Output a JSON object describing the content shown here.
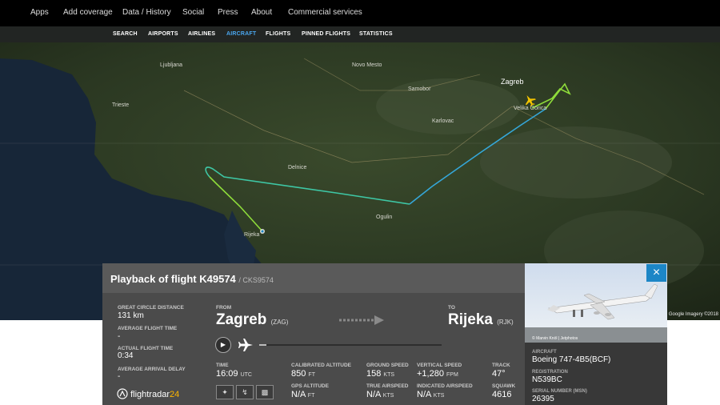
{
  "topnav": [
    {
      "label": "Apps"
    },
    {
      "label": "Add coverage"
    },
    {
      "label": "Data / History"
    },
    {
      "label": "Social"
    },
    {
      "label": "Press"
    },
    {
      "label": "About"
    },
    {
      "label": "Commercial services"
    }
  ],
  "subnav": [
    {
      "label": "SEARCH",
      "active": false
    },
    {
      "label": "AIRPORTS",
      "active": false
    },
    {
      "label": "AIRLINES",
      "active": false
    },
    {
      "label": "AIRCRAFT",
      "active": true
    },
    {
      "label": "FLIGHTS",
      "active": false
    },
    {
      "label": "PINNED FLIGHTS",
      "active": false
    },
    {
      "label": "STATISTICS",
      "active": false
    }
  ],
  "map": {
    "places": [
      "Zagreb",
      "Velika Gorica",
      "Samobor",
      "Trieste",
      "Rijeka",
      "Ljubljana",
      "Novo Mesto",
      "Karlovac",
      "Ogulin",
      "Delnice"
    ],
    "attribution": "Google Imagery ©2018"
  },
  "panel": {
    "title": "Playback of flight K49574",
    "callsign": "/ CKS9574",
    "great_circle_label": "GREAT CIRCLE DISTANCE",
    "great_circle_value": "131 km",
    "avg_flight_label": "AVERAGE FLIGHT TIME",
    "avg_flight_value": "-",
    "actual_flight_label": "ACTUAL FLIGHT TIME",
    "actual_flight_value": "0:34",
    "avg_delay_label": "AVERAGE ARRIVAL DELAY",
    "avg_delay_value": "-",
    "from_label": "FROM",
    "from_city": "Zagreb",
    "from_code": "(ZAG)",
    "to_label": "TO",
    "to_city": "Rijeka",
    "to_code": "(RJK)",
    "time_label": "TIME",
    "time_value": "16:09",
    "time_unit": "UTC",
    "cal_alt_label": "CALIBRATED ALTITUDE",
    "cal_alt_value": "850",
    "cal_alt_unit": "FT",
    "gps_alt_label": "GPS ALTITUDE",
    "gps_alt_value": "N/A",
    "gps_alt_unit": "FT",
    "ground_speed_label": "GROUND SPEED",
    "ground_speed_value": "158",
    "ground_speed_unit": "KTS",
    "true_airspeed_label": "TRUE AIRSPEED",
    "true_airspeed_value": "N/A",
    "true_airspeed_unit": "KTS",
    "vspeed_label": "VERTICAL SPEED",
    "vspeed_value": "+1,280",
    "vspeed_unit": "FPM",
    "ind_airspeed_label": "INDICATED AIRSPEED",
    "ind_airspeed_value": "N/A",
    "ind_airspeed_unit": "KTS",
    "track_label": "TRACK",
    "track_value": "47°",
    "squawk_label": "SQUAWK",
    "squawk_value": "4616",
    "logo_a": "flightradar",
    "logo_b": "24",
    "playback_position": 0.04
  },
  "aircraft": {
    "photo_credit": "© Marvin Knöl | Jetphotos",
    "aircraft_label": "AIRCRAFT",
    "aircraft_value": "Boeing 747-4B5(BCF)",
    "registration_label": "REGISTRATION",
    "registration_value": "N539BC",
    "serial_label": "SERIAL NUMBER (MSN)",
    "serial_value": "26395",
    "close": "×"
  },
  "colors": {
    "track_low": "#3ec7a5",
    "track_mid": "#35a7d8",
    "track_climb": "#8edc3a",
    "accent": "#1c86c6",
    "airport_icon": "#f4c400"
  }
}
